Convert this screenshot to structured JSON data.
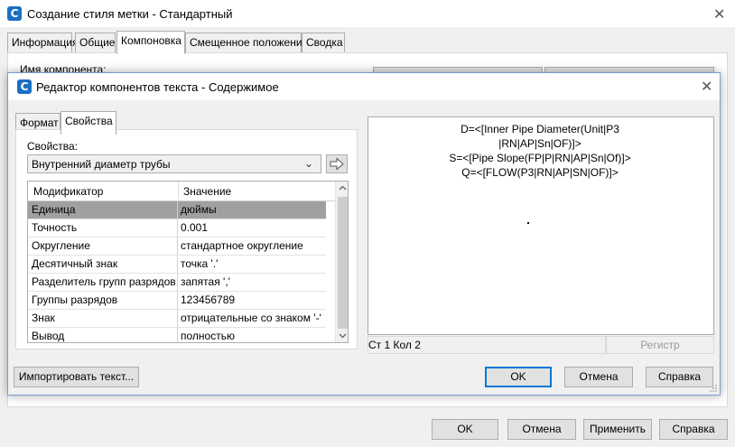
{
  "outer": {
    "title": "Создание стиля метки - Стандартный",
    "tabs": [
      {
        "label": "Информация"
      },
      {
        "label": "Общие"
      },
      {
        "label": "Компоновка"
      },
      {
        "label": "Смещенное положение"
      },
      {
        "label": "Сводка"
      }
    ],
    "active_tab": "Компоновка",
    "component_name_label": "Имя компонента:",
    "buttons": {
      "ok": "OK",
      "cancel": "Отмена",
      "apply": "Применить",
      "help": "Справка"
    }
  },
  "dialog": {
    "title": "Редактор компонентов текста - Содержимое",
    "tabs": [
      {
        "label": "Формат"
      },
      {
        "label": "Свойства"
      }
    ],
    "active_tab": "Свойства",
    "properties_label": "Свойства:",
    "property_selected": "Внутренний диаметр трубы",
    "grid": {
      "headers": {
        "modifier": "Модификатор",
        "value": "Значение"
      },
      "rows": [
        {
          "modifier": "Единица",
          "value": "дюймы",
          "selected": true
        },
        {
          "modifier": "Точность",
          "value": "0.001"
        },
        {
          "modifier": "Округление",
          "value": "стандартное округление"
        },
        {
          "modifier": "Десятичный знак",
          "value": "точка '.'"
        },
        {
          "modifier": "Разделитель групп разрядов",
          "value": "запятая ','"
        },
        {
          "modifier": "Группы разрядов",
          "value": "123456789"
        },
        {
          "modifier": "Знак",
          "value": "отрицательные со знаком '-'"
        },
        {
          "modifier": "Вывод",
          "value": "полностью"
        }
      ]
    },
    "preview_lines": [
      "D=<[Inner Pipe Diameter(Unit|P3",
      "|RN|AP|Sn|OF)]>",
      "S=<[Pipe Slope(FP|P|RN|AP|Sn|Of)]>",
      "Q=<[FLOW(P3|RN|AP|SN|OF)]>"
    ],
    "status": {
      "position": "Ст 1 Кол 2",
      "register": "Регистр"
    },
    "buttons": {
      "import_text": "Импортировать текст...",
      "ok": "OK",
      "cancel": "Отмена",
      "help": "Справка"
    }
  },
  "colors": {
    "accent": "#0078d7",
    "app_icon": "#1a6fc4",
    "selected_row": "#a0a0a0"
  }
}
